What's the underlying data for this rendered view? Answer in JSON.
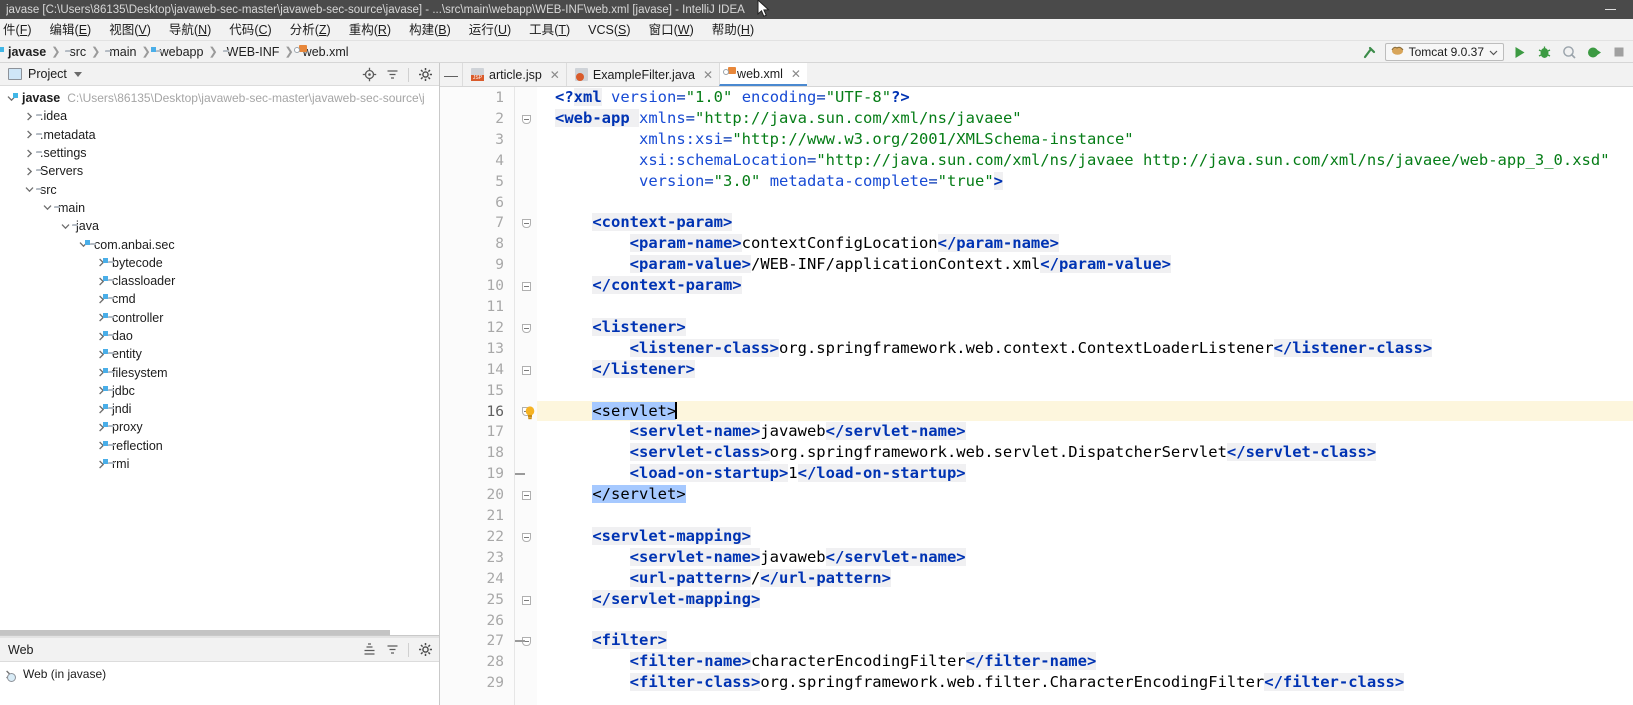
{
  "window": {
    "title": "javase [C:\\Users\\86135\\Desktop\\javaweb-sec-master\\javaweb-sec-source\\javase] - ...\\src\\main\\webapp\\WEB-INF\\web.xml [javase] - IntelliJ IDEA",
    "minimize_label": "—"
  },
  "menubar": {
    "items": [
      {
        "label": "件",
        "mnemonic": "F"
      },
      {
        "label": "编辑",
        "mnemonic": "E"
      },
      {
        "label": "视图",
        "mnemonic": "V"
      },
      {
        "label": "导航",
        "mnemonic": "N"
      },
      {
        "label": "代码",
        "mnemonic": "C"
      },
      {
        "label": "分析",
        "mnemonic": "Z"
      },
      {
        "label": "重构",
        "mnemonic": "R"
      },
      {
        "label": "构建",
        "mnemonic": "B"
      },
      {
        "label": "运行",
        "mnemonic": "U"
      },
      {
        "label": "工具",
        "mnemonic": "T"
      },
      {
        "label": "VCS",
        "mnemonic": "S"
      },
      {
        "label": "窗口",
        "mnemonic": "W"
      },
      {
        "label": "帮助",
        "mnemonic": "H"
      }
    ]
  },
  "breadcrumb": {
    "items": [
      {
        "label": "javase",
        "icon": "module-icon",
        "bold": true
      },
      {
        "label": "src",
        "icon": "folder-icon",
        "bold": false
      },
      {
        "label": "main",
        "icon": "folder-icon",
        "bold": false
      },
      {
        "label": "webapp",
        "icon": "source-folder-icon",
        "bold": false
      },
      {
        "label": "WEB-INF",
        "icon": "folder-icon",
        "bold": false
      },
      {
        "label": "web.xml",
        "icon": "xml-file-icon",
        "bold": false
      }
    ],
    "separator": "❯"
  },
  "toolbar": {
    "run_config": "Tomcat 9.0.37",
    "run_config_icon": "tomcat-icon",
    "icons": [
      "build-hammer-icon",
      "run-icon",
      "debug-icon",
      "run-with-coverage-icon",
      "run-profiler-icon",
      "stop-icon"
    ]
  },
  "project_panel": {
    "title": "Project",
    "header_icons": [
      "locate-icon",
      "collapse-all-icon",
      "settings-gear-icon"
    ],
    "tree": [
      {
        "label": "javase",
        "path": "C:\\Users\\86135\\Desktop\\javaweb-sec-master\\javaweb-sec-source\\j",
        "depth": 0,
        "state": "expanded",
        "bold": true,
        "icon": "module-icon"
      },
      {
        "label": ".idea",
        "depth": 1,
        "state": "collapsed",
        "icon": "folder-icon"
      },
      {
        "label": ".metadata",
        "depth": 1,
        "state": "collapsed",
        "icon": "folder-icon"
      },
      {
        "label": ".settings",
        "depth": 1,
        "state": "collapsed",
        "icon": "folder-icon"
      },
      {
        "label": "Servers",
        "depth": 1,
        "state": "collapsed",
        "icon": "folder-icon"
      },
      {
        "label": "src",
        "depth": 1,
        "state": "expanded",
        "icon": "folder-icon"
      },
      {
        "label": "main",
        "depth": 2,
        "state": "expanded",
        "icon": "folder-icon"
      },
      {
        "label": "java",
        "depth": 3,
        "state": "expanded",
        "icon": "source-folder-icon"
      },
      {
        "label": "com.anbai.sec",
        "depth": 4,
        "state": "expanded",
        "icon": "package-icon"
      },
      {
        "label": "bytecode",
        "depth": 5,
        "state": "collapsed",
        "icon": "package-icon"
      },
      {
        "label": "classloader",
        "depth": 5,
        "state": "collapsed",
        "icon": "package-icon"
      },
      {
        "label": "cmd",
        "depth": 5,
        "state": "collapsed",
        "icon": "package-icon"
      },
      {
        "label": "controller",
        "depth": 5,
        "state": "collapsed",
        "icon": "package-icon"
      },
      {
        "label": "dao",
        "depth": 5,
        "state": "collapsed",
        "icon": "package-icon"
      },
      {
        "label": "entity",
        "depth": 5,
        "state": "collapsed",
        "icon": "package-icon"
      },
      {
        "label": "filesystem",
        "depth": 5,
        "state": "collapsed",
        "icon": "package-icon"
      },
      {
        "label": "jdbc",
        "depth": 5,
        "state": "collapsed",
        "icon": "package-icon"
      },
      {
        "label": "jndi",
        "depth": 5,
        "state": "collapsed",
        "icon": "package-icon"
      },
      {
        "label": "proxy",
        "depth": 5,
        "state": "collapsed",
        "icon": "package-icon"
      },
      {
        "label": "reflection",
        "depth": 5,
        "state": "collapsed",
        "icon": "package-icon"
      },
      {
        "label": "rmi",
        "depth": 5,
        "state": "collapsed",
        "icon": "package-icon"
      }
    ]
  },
  "web_panel": {
    "title": "Web",
    "header_icons": [
      "expand-all-icon",
      "collapse-all-icon",
      "settings-gear-icon"
    ],
    "items": [
      {
        "label": "Web (in javase)",
        "state": "collapsed",
        "icon": "web-facet-icon"
      }
    ]
  },
  "editor_tabs": {
    "collapse_icon": "—",
    "tabs": [
      {
        "label": "article.jsp",
        "icon": "jsp-file-icon",
        "active": false,
        "closable": true
      },
      {
        "label": "ExampleFilter.java",
        "icon": "java-file-icon",
        "active": false,
        "closable": true
      },
      {
        "label": "web.xml",
        "icon": "xml-file-icon",
        "active": true,
        "closable": true
      }
    ]
  },
  "editor": {
    "filename": "web.xml",
    "current_line": 16,
    "lines": [
      {
        "n": 1,
        "segs": [
          {
            "t": "<?",
            "c": "pi"
          },
          {
            "t": "xml",
            "c": "tg"
          },
          {
            "t": " ",
            "c": "txt"
          },
          {
            "t": "version",
            "c": "attr"
          },
          {
            "t": "=",
            "c": "punct"
          },
          {
            "t": "\"1.0\"",
            "c": "val"
          },
          {
            "t": " ",
            "c": "txt"
          },
          {
            "t": "encoding",
            "c": "attr"
          },
          {
            "t": "=",
            "c": "punct"
          },
          {
            "t": "\"UTF-8\"",
            "c": "val"
          },
          {
            "t": "?>",
            "c": "pi"
          }
        ],
        "indent": 0
      },
      {
        "n": 2,
        "segs": [
          {
            "t": "<web-app",
            "c": "tg"
          },
          {
            "t": " ",
            "c": "hl"
          },
          {
            "t": "xmlns",
            "c": "attr"
          },
          {
            "t": "=",
            "c": "punct"
          },
          {
            "t": "\"http://java.sun.com/xml/ns/javaee\"",
            "c": "val"
          }
        ],
        "indent": 0,
        "fold": "start"
      },
      {
        "n": 3,
        "segs": [
          {
            "t": "         ",
            "c": "txt"
          },
          {
            "t": "xmlns:xsi",
            "c": "attr"
          },
          {
            "t": "=",
            "c": "punct"
          },
          {
            "t": "\"http://www.w3.org/2001/XMLSchema-instance\"",
            "c": "val"
          }
        ],
        "indent": 0
      },
      {
        "n": 4,
        "segs": [
          {
            "t": "         ",
            "c": "txt"
          },
          {
            "t": "xsi:schemaLocation",
            "c": "attr"
          },
          {
            "t": "=",
            "c": "punct"
          },
          {
            "t": "\"http://java.sun.com/xml/ns/javaee http://java.sun.com/xml/ns/javaee/web-app_3_0.xsd\"",
            "c": "val"
          }
        ],
        "indent": 0
      },
      {
        "n": 5,
        "segs": [
          {
            "t": "         ",
            "c": "txt"
          },
          {
            "t": "version",
            "c": "attr"
          },
          {
            "t": "=",
            "c": "punct"
          },
          {
            "t": "\"3.0\"",
            "c": "val"
          },
          {
            "t": " ",
            "c": "txt"
          },
          {
            "t": "metadata-complete",
            "c": "attr"
          },
          {
            "t": "=",
            "c": "punct"
          },
          {
            "t": "\"true\"",
            "c": "val"
          },
          {
            "t": ">",
            "c": "tg"
          }
        ],
        "indent": 0
      },
      {
        "n": 6,
        "segs": [],
        "indent": 0
      },
      {
        "n": 7,
        "segs": [
          {
            "t": "    ",
            "c": "txt"
          },
          {
            "t": "<context-param>",
            "c": "tg"
          }
        ],
        "indent": 0,
        "fold": "start"
      },
      {
        "n": 8,
        "segs": [
          {
            "t": "        ",
            "c": "txt"
          },
          {
            "t": "<param-name>",
            "c": "tg"
          },
          {
            "t": "contextConfigLocation",
            "c": "txt"
          },
          {
            "t": "</param-name>",
            "c": "tg"
          }
        ],
        "indent": 0
      },
      {
        "n": 9,
        "segs": [
          {
            "t": "        ",
            "c": "txt"
          },
          {
            "t": "<param-value>",
            "c": "tg"
          },
          {
            "t": "/WEB-INF/applicationContext.xml",
            "c": "txt"
          },
          {
            "t": "</param-value>",
            "c": "tg"
          }
        ],
        "indent": 0
      },
      {
        "n": 10,
        "segs": [
          {
            "t": "    ",
            "c": "txt"
          },
          {
            "t": "</context-param>",
            "c": "tg"
          }
        ],
        "indent": 0,
        "fold": "end"
      },
      {
        "n": 11,
        "segs": [],
        "indent": 0
      },
      {
        "n": 12,
        "segs": [
          {
            "t": "    ",
            "c": "txt"
          },
          {
            "t": "<listener>",
            "c": "tg"
          }
        ],
        "indent": 0,
        "fold": "start"
      },
      {
        "n": 13,
        "segs": [
          {
            "t": "        ",
            "c": "txt"
          },
          {
            "t": "<listener-class>",
            "c": "tg"
          },
          {
            "t": "org.springframework.web.context.ContextLoaderListener",
            "c": "txt"
          },
          {
            "t": "</listener-class>",
            "c": "tg"
          }
        ],
        "indent": 0
      },
      {
        "n": 14,
        "segs": [
          {
            "t": "    ",
            "c": "txt"
          },
          {
            "t": "</listener>",
            "c": "tg"
          }
        ],
        "indent": 0,
        "fold": "end"
      },
      {
        "n": 15,
        "segs": [],
        "indent": 0
      },
      {
        "n": 16,
        "segs": [
          {
            "t": "    ",
            "c": "txt"
          },
          {
            "t": "<servlet>",
            "c": "sel"
          }
        ],
        "indent": 0,
        "fold": "start",
        "current": true,
        "bulb": true,
        "caret": true
      },
      {
        "n": 17,
        "segs": [
          {
            "t": "        ",
            "c": "txt"
          },
          {
            "t": "<servlet-name>",
            "c": "tg"
          },
          {
            "t": "javaweb",
            "c": "txt"
          },
          {
            "t": "</servlet-name>",
            "c": "tg"
          }
        ],
        "indent": 0
      },
      {
        "n": 18,
        "segs": [
          {
            "t": "        ",
            "c": "txt"
          },
          {
            "t": "<servlet-class>",
            "c": "tg"
          },
          {
            "t": "org.springframework.web.servlet.DispatcherServlet",
            "c": "txt"
          },
          {
            "t": "</servlet-class>",
            "c": "tg"
          }
        ],
        "indent": 0
      },
      {
        "n": 19,
        "segs": [
          {
            "t": "        ",
            "c": "txt"
          },
          {
            "t": "<load-on-startup>",
            "c": "tg"
          },
          {
            "t": "1",
            "c": "txt"
          },
          {
            "t": "</load-on-startup>",
            "c": "tg"
          }
        ],
        "indent": 0
      },
      {
        "n": 20,
        "segs": [
          {
            "t": "    ",
            "c": "txt"
          },
          {
            "t": "</servlet>",
            "c": "sel"
          }
        ],
        "indent": 0,
        "fold": "end"
      },
      {
        "n": 21,
        "segs": [],
        "indent": 0
      },
      {
        "n": 22,
        "segs": [
          {
            "t": "    ",
            "c": "txt"
          },
          {
            "t": "<servlet-mapping>",
            "c": "tg"
          }
        ],
        "indent": 0,
        "fold": "start"
      },
      {
        "n": 23,
        "segs": [
          {
            "t": "        ",
            "c": "txt"
          },
          {
            "t": "<servlet-name>",
            "c": "tg"
          },
          {
            "t": "javaweb",
            "c": "txt"
          },
          {
            "t": "</servlet-name>",
            "c": "tg"
          }
        ],
        "indent": 0
      },
      {
        "n": 24,
        "segs": [
          {
            "t": "        ",
            "c": "txt"
          },
          {
            "t": "<url-pattern>",
            "c": "tg"
          },
          {
            "t": "/",
            "c": "txt"
          },
          {
            "t": "</url-pattern>",
            "c": "tg"
          }
        ],
        "indent": 0
      },
      {
        "n": 25,
        "segs": [
          {
            "t": "    ",
            "c": "txt"
          },
          {
            "t": "</servlet-mapping>",
            "c": "tg"
          }
        ],
        "indent": 0,
        "fold": "end"
      },
      {
        "n": 26,
        "segs": [],
        "indent": 0
      },
      {
        "n": 27,
        "segs": [
          {
            "t": "    ",
            "c": "txt"
          },
          {
            "t": "<filter>",
            "c": "tg"
          }
        ],
        "indent": 0,
        "fold": "start"
      },
      {
        "n": 28,
        "segs": [
          {
            "t": "        ",
            "c": "txt"
          },
          {
            "t": "<filter-name>",
            "c": "tg"
          },
          {
            "t": "characterEncodingFilter",
            "c": "txt"
          },
          {
            "t": "</filter-name>",
            "c": "tg"
          }
        ],
        "indent": 0
      },
      {
        "n": 29,
        "segs": [
          {
            "t": "        ",
            "c": "txt"
          },
          {
            "t": "<filter-class>",
            "c": "tg"
          },
          {
            "t": "org.springframework.web.filter.CharacterEncodingFilter",
            "c": "txt"
          },
          {
            "t": "</filter-class>",
            "c": "tg"
          }
        ],
        "indent": 0
      }
    ]
  },
  "colors": {
    "titlebar_bg": "#4a4a4a",
    "chrome_bg": "#f2f2f2",
    "tag": "#0033b3",
    "attr": "#174ad4",
    "value": "#067d17",
    "selection": "#a6c9ff",
    "current_line": "#fdf6dd",
    "accent": "#4a89d0"
  }
}
